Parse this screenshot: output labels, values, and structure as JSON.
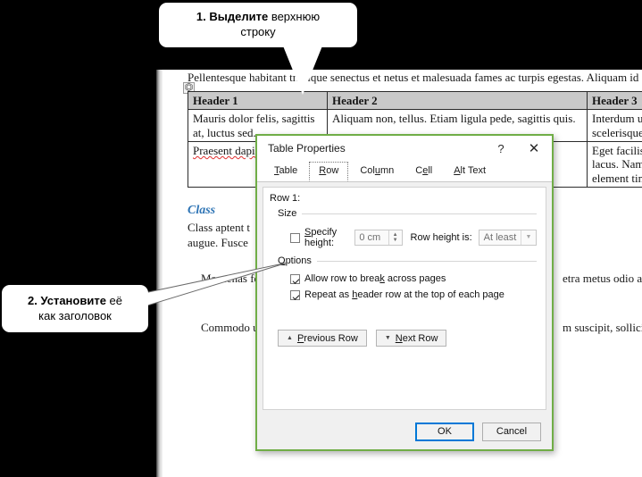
{
  "callouts": [
    {
      "name": "step-1",
      "bold": "1. Выделите",
      "rest": " верхнюю",
      "line2": "строку"
    },
    {
      "name": "step-2",
      "bold": "2. Установите",
      "rest": " её",
      "line2": "как заголовок"
    }
  ],
  "document": {
    "paragraph_top": "Pellentesque habitant tristique senectus et netus et malesuada fames ac turpis egestas. Aliquam id d",
    "table": {
      "handle_icon": "table-move-handle",
      "headers": [
        "Header 1",
        "Header 2",
        "Header 3"
      ],
      "rows": [
        [
          "Mauris dolor felis, sagittis at, luctus sed.",
          "Aliquam non, tellus. Etiam ligula pede, sagittis quis.",
          "Interdum ultric scelerisque eu,"
        ],
        [
          "Praesent dapil",
          "",
          "Eget facilisis e id lacus. Nam magna element tincidunt."
        ]
      ]
    },
    "heading_class": "Class",
    "para_class_1": "Class aptent t",
    "para_class_2": "augue. Fusce",
    "para_maecenas": "Maecenas fer",
    "para_maecenas_right": "etra metus odio a le",
    "para_commodo": "Commodo u",
    "para_commodo_right": "m suscipit, sollicitu"
  },
  "dialog": {
    "title": "Table Properties",
    "help_icon": "?",
    "close_icon": "✕",
    "tabs": [
      {
        "label": "Table",
        "accel": "T",
        "active": false
      },
      {
        "label": "Row",
        "accel": "R",
        "active": true
      },
      {
        "label": "Column",
        "accel": "u",
        "active": false
      },
      {
        "label": "Cell",
        "accel": "e",
        "active": false
      },
      {
        "label": "Alt Text",
        "accel": "A",
        "active": false
      }
    ],
    "row_label": "Row 1:",
    "size_group": {
      "title": "Size",
      "specify_height_label": "Specify height:",
      "specify_height_checked": false,
      "height_value": "0 cm",
      "row_height_is_label": "Row height is:",
      "row_height_value": "At least"
    },
    "options_group": {
      "title": "Options",
      "items": [
        {
          "label": "Allow row to break across pages",
          "checked": true
        },
        {
          "label": "Repeat as header row at the top of each page",
          "checked": true
        }
      ]
    },
    "previous_row_label": "Previous Row",
    "next_row_label": "Next Row",
    "ok_label": "OK",
    "cancel_label": "Cancel"
  },
  "colors": {
    "dialog_border": "#70ad47",
    "focus_blue": "#0078d7",
    "heading_blue": "#2e74b5",
    "table_header_fill": "#c9c9c9",
    "spell_underline": "#e03030"
  }
}
